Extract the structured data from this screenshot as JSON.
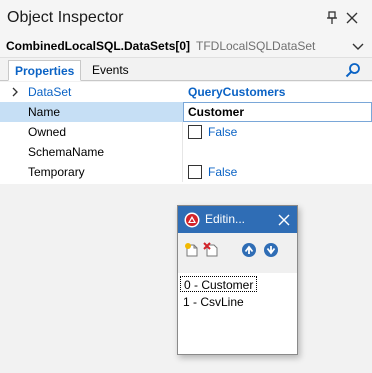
{
  "window": {
    "title": "Object Inspector",
    "pin_icon": "pin-icon",
    "close_icon": "close-icon"
  },
  "object_selector": {
    "name": "CombinedLocalSQL.DataSets[0]",
    "type": "TFDLocalSQLDataSet"
  },
  "tabs": [
    {
      "label": "Properties",
      "active": true
    },
    {
      "label": "Events",
      "active": false
    }
  ],
  "properties": [
    {
      "label": "DataSet",
      "value": "QueryCustomers",
      "expandable": true
    },
    {
      "label": "Name",
      "value": "Customer",
      "selected": true
    },
    {
      "label": "Owned",
      "value": "False",
      "checkbox": true
    },
    {
      "label": "SchemaName",
      "value": ""
    },
    {
      "label": "Temporary",
      "value": "False",
      "checkbox": true
    }
  ],
  "collection_editor": {
    "title": "Editin...",
    "toolbar": [
      "add-new-icon",
      "delete-icon",
      "move-up-icon",
      "move-down-icon"
    ],
    "items": [
      "0 - Customer",
      "1 - CsvLine"
    ],
    "selected_index": 0
  },
  "colors": {
    "accent": "#0b63c5",
    "editor_header": "#2f6db5",
    "selection": "#c6dff5"
  }
}
